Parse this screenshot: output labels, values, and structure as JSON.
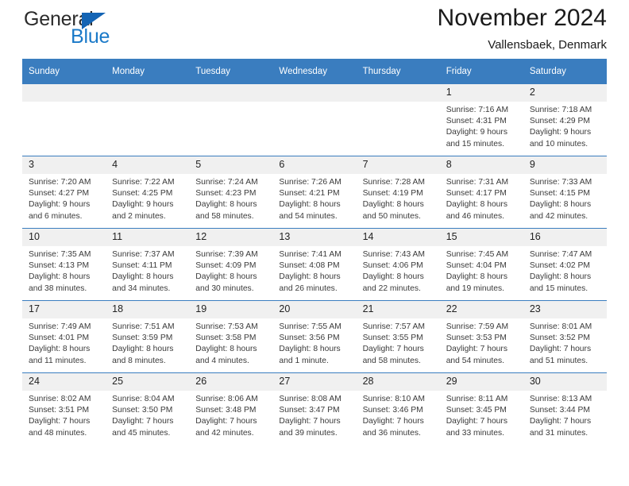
{
  "brand": {
    "name_part1": "General",
    "name_part2": "Blue",
    "triangle_color": "#1464b4",
    "blue_color": "#1a79c8"
  },
  "header": {
    "title": "November 2024",
    "subtitle": "Vallensbaek, Denmark"
  },
  "colors": {
    "header_row": "#3a7dbf",
    "daynum_band": "#f0f0f0",
    "grid_line": "#3a7dbf"
  },
  "weekdays": [
    "Sunday",
    "Monday",
    "Tuesday",
    "Wednesday",
    "Thursday",
    "Friday",
    "Saturday"
  ],
  "weeks": [
    [
      {
        "day": "",
        "blank": true
      },
      {
        "day": "",
        "blank": true
      },
      {
        "day": "",
        "blank": true
      },
      {
        "day": "",
        "blank": true
      },
      {
        "day": "",
        "blank": true
      },
      {
        "day": "1",
        "sunrise": "Sunrise: 7:16 AM",
        "sunset": "Sunset: 4:31 PM",
        "daylight1": "Daylight: 9 hours",
        "daylight2": "and 15 minutes."
      },
      {
        "day": "2",
        "sunrise": "Sunrise: 7:18 AM",
        "sunset": "Sunset: 4:29 PM",
        "daylight1": "Daylight: 9 hours",
        "daylight2": "and 10 minutes."
      }
    ],
    [
      {
        "day": "3",
        "sunrise": "Sunrise: 7:20 AM",
        "sunset": "Sunset: 4:27 PM",
        "daylight1": "Daylight: 9 hours",
        "daylight2": "and 6 minutes."
      },
      {
        "day": "4",
        "sunrise": "Sunrise: 7:22 AM",
        "sunset": "Sunset: 4:25 PM",
        "daylight1": "Daylight: 9 hours",
        "daylight2": "and 2 minutes."
      },
      {
        "day": "5",
        "sunrise": "Sunrise: 7:24 AM",
        "sunset": "Sunset: 4:23 PM",
        "daylight1": "Daylight: 8 hours",
        "daylight2": "and 58 minutes."
      },
      {
        "day": "6",
        "sunrise": "Sunrise: 7:26 AM",
        "sunset": "Sunset: 4:21 PM",
        "daylight1": "Daylight: 8 hours",
        "daylight2": "and 54 minutes."
      },
      {
        "day": "7",
        "sunrise": "Sunrise: 7:28 AM",
        "sunset": "Sunset: 4:19 PM",
        "daylight1": "Daylight: 8 hours",
        "daylight2": "and 50 minutes."
      },
      {
        "day": "8",
        "sunrise": "Sunrise: 7:31 AM",
        "sunset": "Sunset: 4:17 PM",
        "daylight1": "Daylight: 8 hours",
        "daylight2": "and 46 minutes."
      },
      {
        "day": "9",
        "sunrise": "Sunrise: 7:33 AM",
        "sunset": "Sunset: 4:15 PM",
        "daylight1": "Daylight: 8 hours",
        "daylight2": "and 42 minutes."
      }
    ],
    [
      {
        "day": "10",
        "sunrise": "Sunrise: 7:35 AM",
        "sunset": "Sunset: 4:13 PM",
        "daylight1": "Daylight: 8 hours",
        "daylight2": "and 38 minutes."
      },
      {
        "day": "11",
        "sunrise": "Sunrise: 7:37 AM",
        "sunset": "Sunset: 4:11 PM",
        "daylight1": "Daylight: 8 hours",
        "daylight2": "and 34 minutes."
      },
      {
        "day": "12",
        "sunrise": "Sunrise: 7:39 AM",
        "sunset": "Sunset: 4:09 PM",
        "daylight1": "Daylight: 8 hours",
        "daylight2": "and 30 minutes."
      },
      {
        "day": "13",
        "sunrise": "Sunrise: 7:41 AM",
        "sunset": "Sunset: 4:08 PM",
        "daylight1": "Daylight: 8 hours",
        "daylight2": "and 26 minutes."
      },
      {
        "day": "14",
        "sunrise": "Sunrise: 7:43 AM",
        "sunset": "Sunset: 4:06 PM",
        "daylight1": "Daylight: 8 hours",
        "daylight2": "and 22 minutes."
      },
      {
        "day": "15",
        "sunrise": "Sunrise: 7:45 AM",
        "sunset": "Sunset: 4:04 PM",
        "daylight1": "Daylight: 8 hours",
        "daylight2": "and 19 minutes."
      },
      {
        "day": "16",
        "sunrise": "Sunrise: 7:47 AM",
        "sunset": "Sunset: 4:02 PM",
        "daylight1": "Daylight: 8 hours",
        "daylight2": "and 15 minutes."
      }
    ],
    [
      {
        "day": "17",
        "sunrise": "Sunrise: 7:49 AM",
        "sunset": "Sunset: 4:01 PM",
        "daylight1": "Daylight: 8 hours",
        "daylight2": "and 11 minutes."
      },
      {
        "day": "18",
        "sunrise": "Sunrise: 7:51 AM",
        "sunset": "Sunset: 3:59 PM",
        "daylight1": "Daylight: 8 hours",
        "daylight2": "and 8 minutes."
      },
      {
        "day": "19",
        "sunrise": "Sunrise: 7:53 AM",
        "sunset": "Sunset: 3:58 PM",
        "daylight1": "Daylight: 8 hours",
        "daylight2": "and 4 minutes."
      },
      {
        "day": "20",
        "sunrise": "Sunrise: 7:55 AM",
        "sunset": "Sunset: 3:56 PM",
        "daylight1": "Daylight: 8 hours",
        "daylight2": "and 1 minute."
      },
      {
        "day": "21",
        "sunrise": "Sunrise: 7:57 AM",
        "sunset": "Sunset: 3:55 PM",
        "daylight1": "Daylight: 7 hours",
        "daylight2": "and 58 minutes."
      },
      {
        "day": "22",
        "sunrise": "Sunrise: 7:59 AM",
        "sunset": "Sunset: 3:53 PM",
        "daylight1": "Daylight: 7 hours",
        "daylight2": "and 54 minutes."
      },
      {
        "day": "23",
        "sunrise": "Sunrise: 8:01 AM",
        "sunset": "Sunset: 3:52 PM",
        "daylight1": "Daylight: 7 hours",
        "daylight2": "and 51 minutes."
      }
    ],
    [
      {
        "day": "24",
        "sunrise": "Sunrise: 8:02 AM",
        "sunset": "Sunset: 3:51 PM",
        "daylight1": "Daylight: 7 hours",
        "daylight2": "and 48 minutes."
      },
      {
        "day": "25",
        "sunrise": "Sunrise: 8:04 AM",
        "sunset": "Sunset: 3:50 PM",
        "daylight1": "Daylight: 7 hours",
        "daylight2": "and 45 minutes."
      },
      {
        "day": "26",
        "sunrise": "Sunrise: 8:06 AM",
        "sunset": "Sunset: 3:48 PM",
        "daylight1": "Daylight: 7 hours",
        "daylight2": "and 42 minutes."
      },
      {
        "day": "27",
        "sunrise": "Sunrise: 8:08 AM",
        "sunset": "Sunset: 3:47 PM",
        "daylight1": "Daylight: 7 hours",
        "daylight2": "and 39 minutes."
      },
      {
        "day": "28",
        "sunrise": "Sunrise: 8:10 AM",
        "sunset": "Sunset: 3:46 PM",
        "daylight1": "Daylight: 7 hours",
        "daylight2": "and 36 minutes."
      },
      {
        "day": "29",
        "sunrise": "Sunrise: 8:11 AM",
        "sunset": "Sunset: 3:45 PM",
        "daylight1": "Daylight: 7 hours",
        "daylight2": "and 33 minutes."
      },
      {
        "day": "30",
        "sunrise": "Sunrise: 8:13 AM",
        "sunset": "Sunset: 3:44 PM",
        "daylight1": "Daylight: 7 hours",
        "daylight2": "and 31 minutes."
      }
    ]
  ]
}
